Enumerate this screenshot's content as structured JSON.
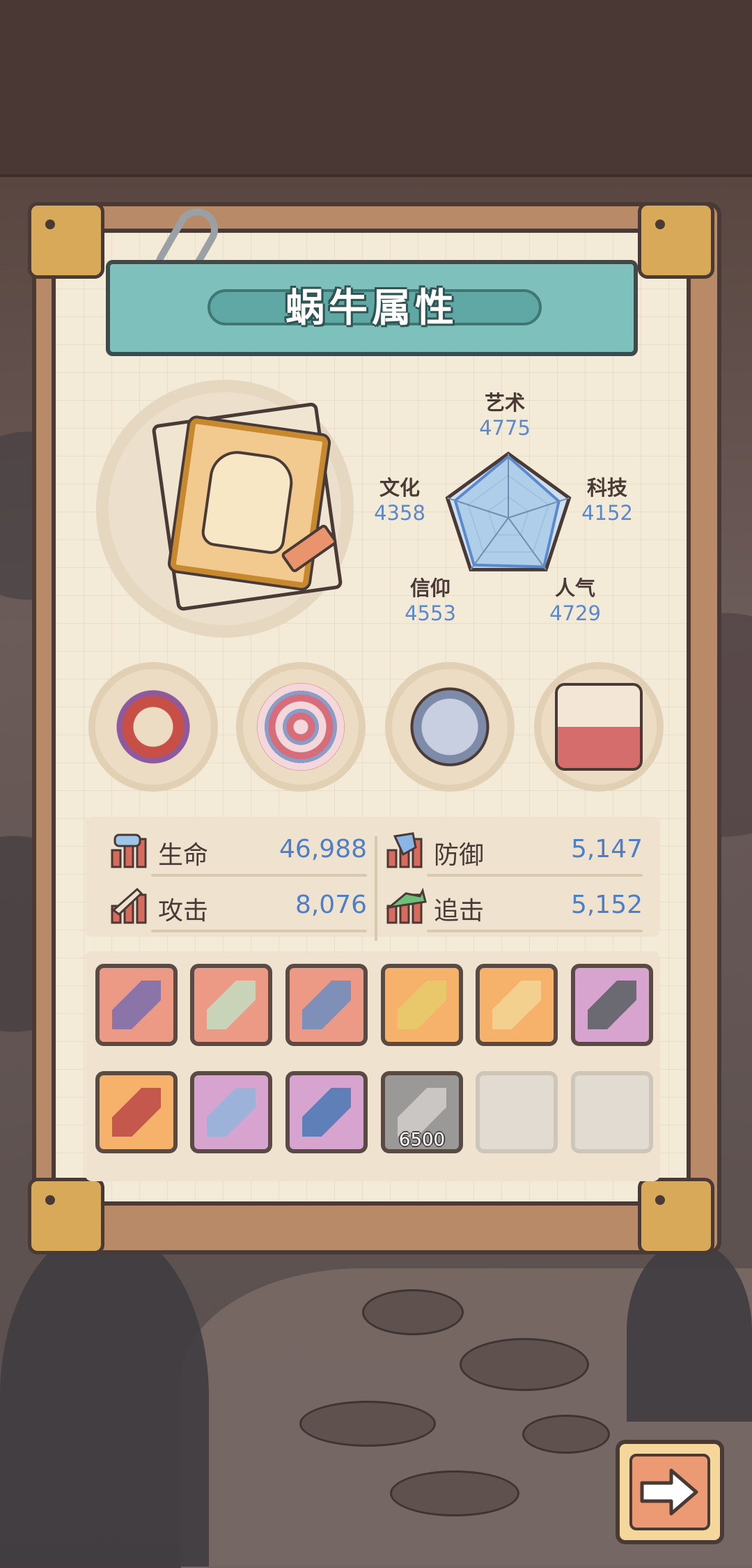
{
  "title": "蜗牛属性",
  "radar": {
    "stats": [
      {
        "name": "艺术",
        "value": "4775"
      },
      {
        "name": "科技",
        "value": "4152"
      },
      {
        "name": "人气",
        "value": "4729"
      },
      {
        "name": "信仰",
        "value": "4553"
      },
      {
        "name": "文化",
        "value": "4358"
      }
    ],
    "fill_color": "#a9cbe8",
    "line_color": "#5b89cc"
  },
  "equipment_circles": [
    {
      "icon": "thorny-ring-relic-icon"
    },
    {
      "icon": "snail-shell-icon"
    },
    {
      "icon": "compass-icon"
    },
    {
      "icon": "potion-crate-icon"
    }
  ],
  "combat_stats": [
    {
      "label": "生命",
      "value": "46,988",
      "icon": "health-bars-icon"
    },
    {
      "label": "防御",
      "value": "5,147",
      "icon": "defense-bars-icon"
    },
    {
      "label": "攻击",
      "value": "8,076",
      "icon": "attack-bars-icon"
    },
    {
      "label": "追击",
      "value": "5,152",
      "icon": "pursuit-bars-icon"
    }
  ],
  "gear_slots": [
    {
      "icon": "bandage-armband-icon",
      "rarity": "red"
    },
    {
      "icon": "sword-icon",
      "rarity": "red"
    },
    {
      "icon": "mech-gauntlet-icon",
      "rarity": "red"
    },
    {
      "icon": "winged-helmet-icon",
      "rarity": "orange"
    },
    {
      "icon": "light-saber-icon",
      "rarity": "orange"
    },
    {
      "icon": "scythe-hammer-icon",
      "rarity": "purple"
    },
    {
      "icon": "chain-weight-icon",
      "rarity": "orange"
    },
    {
      "icon": "dagger-icon",
      "rarity": "purple"
    },
    {
      "icon": "crest-emblem-icon",
      "rarity": "purple"
    },
    {
      "icon": "scroll-icon",
      "rarity": "gray",
      "cost": "6500"
    },
    {
      "icon": "",
      "rarity": "empty"
    },
    {
      "icon": "",
      "rarity": "empty"
    }
  ],
  "colors": {
    "board": "#b98a68",
    "paper": "#f4ead8",
    "banner": "#7ec0bc",
    "value_blue": "#4f7ec8"
  }
}
